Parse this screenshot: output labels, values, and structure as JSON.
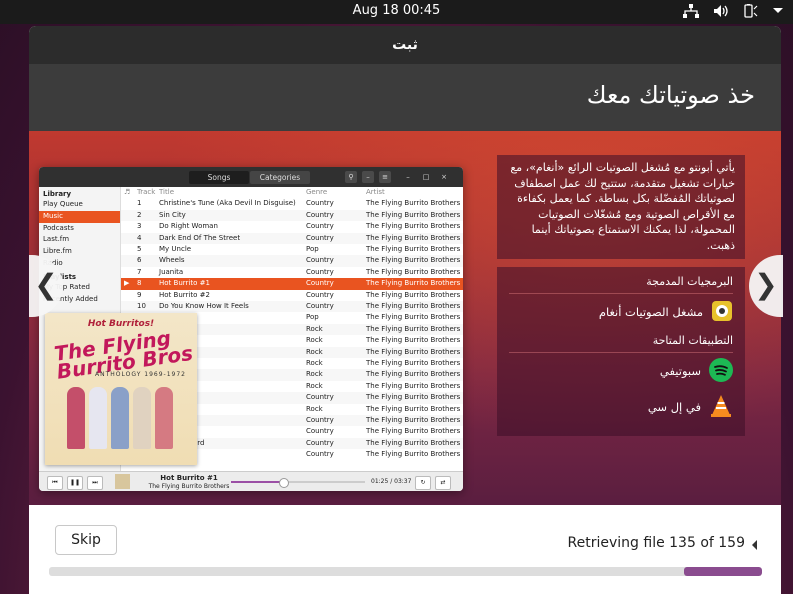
{
  "topbar": {
    "clock": "Aug 18  00:45"
  },
  "window": {
    "title": "ثبت"
  },
  "slide": {
    "heading": "خذ صوتياتك معك",
    "description": "يأتي أبونتو مع مُشغل الصوتيات الرائع «أنغام»، مع خيارات تشغيل متقدمة، ستتيح لك عمل اصطفاف لصوتياتك المُفضّلة بكل بساطة. كما يعمل بكفاءة مع الأقراص الصوتية ومع مُشغّلات الصوتيات المحمولة، لذا يمكنك الاستمتاع بصوتياتك أينما ذهبت.",
    "bundled_heading": "البرمجيات المدمجة",
    "bundled": [
      {
        "name": "مشغل الصوتيات أنغام",
        "icon": "rhythmbox-icon"
      }
    ],
    "available_heading": "التطبيقات المتاحة",
    "available": [
      {
        "name": "سبوتيفي",
        "icon": "spotify-icon"
      },
      {
        "name": "في إل سي",
        "icon": "vlc-icon"
      }
    ]
  },
  "music_app": {
    "tabs": [
      "Songs",
      "Categories"
    ],
    "sidebar_library": "Library",
    "library_items": [
      "Play Queue",
      "Music",
      "Podcasts",
      "Last.fm",
      "Libre.fm",
      "Radio"
    ],
    "sidebar_playlists": "Playlists",
    "playlist_items": [
      "My Top Rated",
      "Recently Added"
    ],
    "columns": [
      "Track",
      "Title",
      "Genre",
      "Artist"
    ],
    "rows": [
      [
        "1",
        "Christine's Tune (Aka Devil In Disguise)",
        "Country",
        "The Flying Burrito Brothers"
      ],
      [
        "2",
        "Sin City",
        "Country",
        "The Flying Burrito Brothers"
      ],
      [
        "3",
        "Do Right Woman",
        "Country",
        "The Flying Burrito Brothers"
      ],
      [
        "4",
        "Dark End Of The Street",
        "Country",
        "The Flying Burrito Brothers"
      ],
      [
        "5",
        "My Uncle",
        "Pop",
        "The Flying Burrito Brothers"
      ],
      [
        "6",
        "Wheels",
        "Country",
        "The Flying Burrito Brothers"
      ],
      [
        "7",
        "Juanita",
        "Country",
        "The Flying Burrito Brothers"
      ],
      [
        "8",
        "Hot Burrito #1",
        "Country",
        "The Flying Burrito Brothers"
      ],
      [
        "9",
        "Hot Burrito #2",
        "Country",
        "The Flying Burrito Brothers"
      ],
      [
        "10",
        "Do You Know How It Feels",
        "Country",
        "The Flying Burrito Brothers"
      ],
      [
        "11",
        "",
        "Pop",
        "The Flying Burrito Brothers"
      ],
      [
        "12",
        "ng",
        "Rock",
        "The Flying Burrito Brothers"
      ],
      [
        "13",
        "",
        "Rock",
        "The Flying Burrito Brothers"
      ],
      [
        "14",
        "e",
        "Rock",
        "The Flying Burrito Brothers"
      ],
      [
        "15",
        "n Queen",
        "Rock",
        "The Flying Burrito Brothers"
      ],
      [
        "16",
        "Go",
        "Rock",
        "The Flying Burrito Brothers"
      ],
      [
        "17",
        "Fog",
        "Rock",
        "The Flying Burrito Brothers"
      ],
      [
        "18",
        "g",
        "Country",
        "The Flying Burrito Brothers"
      ],
      [
        "19",
        "",
        "Rock",
        "The Flying Burrito Brothers"
      ],
      [
        "20",
        "",
        "Country",
        "The Flying Burrito Brothers"
      ],
      [
        "21",
        "Singer",
        "Country",
        "The Flying Burrito Brothers"
      ],
      [
        "22",
        "r Churchyard",
        "Country",
        "The Flying Burrito Brothers"
      ],
      [
        "23",
        "s",
        "Country",
        "The Flying Burrito Brothers"
      ]
    ],
    "selected_row": 7,
    "cover": {
      "line1": "Hot Burritos!",
      "line2": "The Flying Burrito Bros",
      "line3": "ANTHOLOGY 1969-1972"
    },
    "now_playing_title": "Hot Burrito #1",
    "now_playing_artist": "The Flying Burrito Brothers",
    "time": "01:25 / 03:37",
    "progress_fraction": 0.39
  },
  "footer": {
    "skip_label": "Skip",
    "status": "Retrieving file 135 of 159",
    "progress_fraction": 0.11
  },
  "colors": {
    "accent": "#e95420",
    "progress": "#8a4c8f"
  }
}
